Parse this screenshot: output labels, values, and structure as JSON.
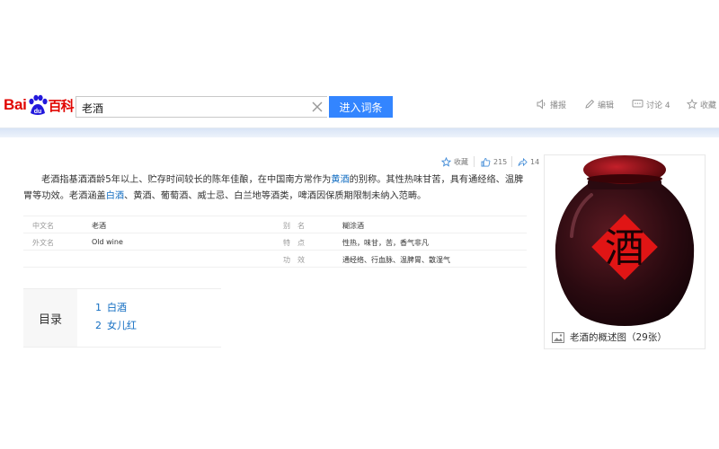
{
  "header": {
    "logo_text_latin": "Bai",
    "logo_text_paw": "du",
    "logo_text_cn": "百科",
    "search_value": "老酒",
    "search_button": "进入词条",
    "actions": [
      {
        "label": "播报",
        "icon": "speaker-icon"
      },
      {
        "label": "编辑",
        "icon": "edit-icon"
      },
      {
        "label": "讨论 4",
        "icon": "discuss-icon"
      },
      {
        "label": "收藏",
        "icon": "star-icon"
      }
    ]
  },
  "meta": {
    "collect_label": "收藏",
    "like_count": "215",
    "share_count": "14"
  },
  "summary": {
    "seg1": "老酒指基酒酒龄5年以上、贮存时间较长的陈年佳酿，在中国南方常作为",
    "link1": "黄酒",
    "seg2": "的别称。其性热味甘苦，具有通经络、温脾胃等功效。老酒涵盖",
    "link2": "白酒",
    "seg3": "、黄酒、葡萄酒、威士忌、白兰地等酒类，啤酒因保质期限制未纳入范畴。"
  },
  "basic_info": {
    "left": [
      {
        "name": "中文名",
        "value": "老酒"
      },
      {
        "name": "外文名",
        "value": "Old wine"
      }
    ],
    "right": [
      {
        "name": "别　名",
        "value": "糊涂酒"
      },
      {
        "name": "特　点",
        "value": "性热，味甘，苦，香气非凡"
      },
      {
        "name": "功　效",
        "value": "通经络、行血脉、温脾胃、散湿气"
      }
    ]
  },
  "catalog": {
    "title": "目录",
    "items": [
      {
        "num": "1",
        "label": "白酒"
      },
      {
        "num": "2",
        "label": "女儿红"
      }
    ]
  },
  "image_card": {
    "jar_character": "酒",
    "caption": "老酒的概述图（29张）"
  },
  "colors": {
    "brand_red": "#e10602",
    "brand_blue": "#2319dc",
    "button_blue": "#3385ff",
    "link_blue": "#136ec2"
  }
}
